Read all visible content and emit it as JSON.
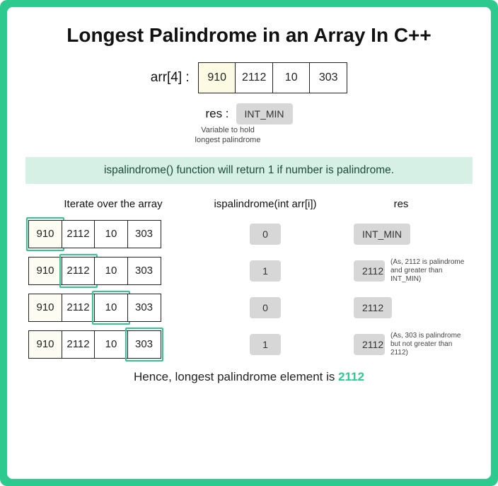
{
  "title": "Longest Palindrome in an Array In C++",
  "array_label": "arr[4] :",
  "array_values": [
    "910",
    "2112",
    "10",
    "303"
  ],
  "array_hl": 0,
  "res_label": "res :",
  "res_initial": "INT_MIN",
  "var_note_line1": "Variable to hold",
  "var_note_line2": "longest palindrome",
  "banner": "ispalindrome() function will return 1 if number is palindrome.",
  "headers": {
    "iterate": "Iterate over the array",
    "ispal": "ispalindrome(int arr[i])",
    "res": "res"
  },
  "iterations": [
    {
      "cells": [
        "910",
        "2112",
        "10",
        "303"
      ],
      "cursor": 0,
      "hl": 0,
      "pal": "0",
      "res": "INT_MIN",
      "note": ""
    },
    {
      "cells": [
        "910",
        "2112",
        "10",
        "303"
      ],
      "cursor": 1,
      "hl": 0,
      "pal": "1",
      "res": "2112",
      "note": "(As, 2112 is palindrome and greater than INT_MIN)"
    },
    {
      "cells": [
        "910",
        "2112",
        "10",
        "303"
      ],
      "cursor": 2,
      "hl": 0,
      "pal": "0",
      "res": "2112",
      "note": ""
    },
    {
      "cells": [
        "910",
        "2112",
        "10",
        "303"
      ],
      "cursor": 3,
      "hl": 0,
      "pal": "1",
      "res": "2112",
      "note": "(As, 303 is palindrome but not greater than 2112)"
    }
  ],
  "conclusion_prefix": "Hence, longest palindrome element is ",
  "conclusion_answer": "2112"
}
